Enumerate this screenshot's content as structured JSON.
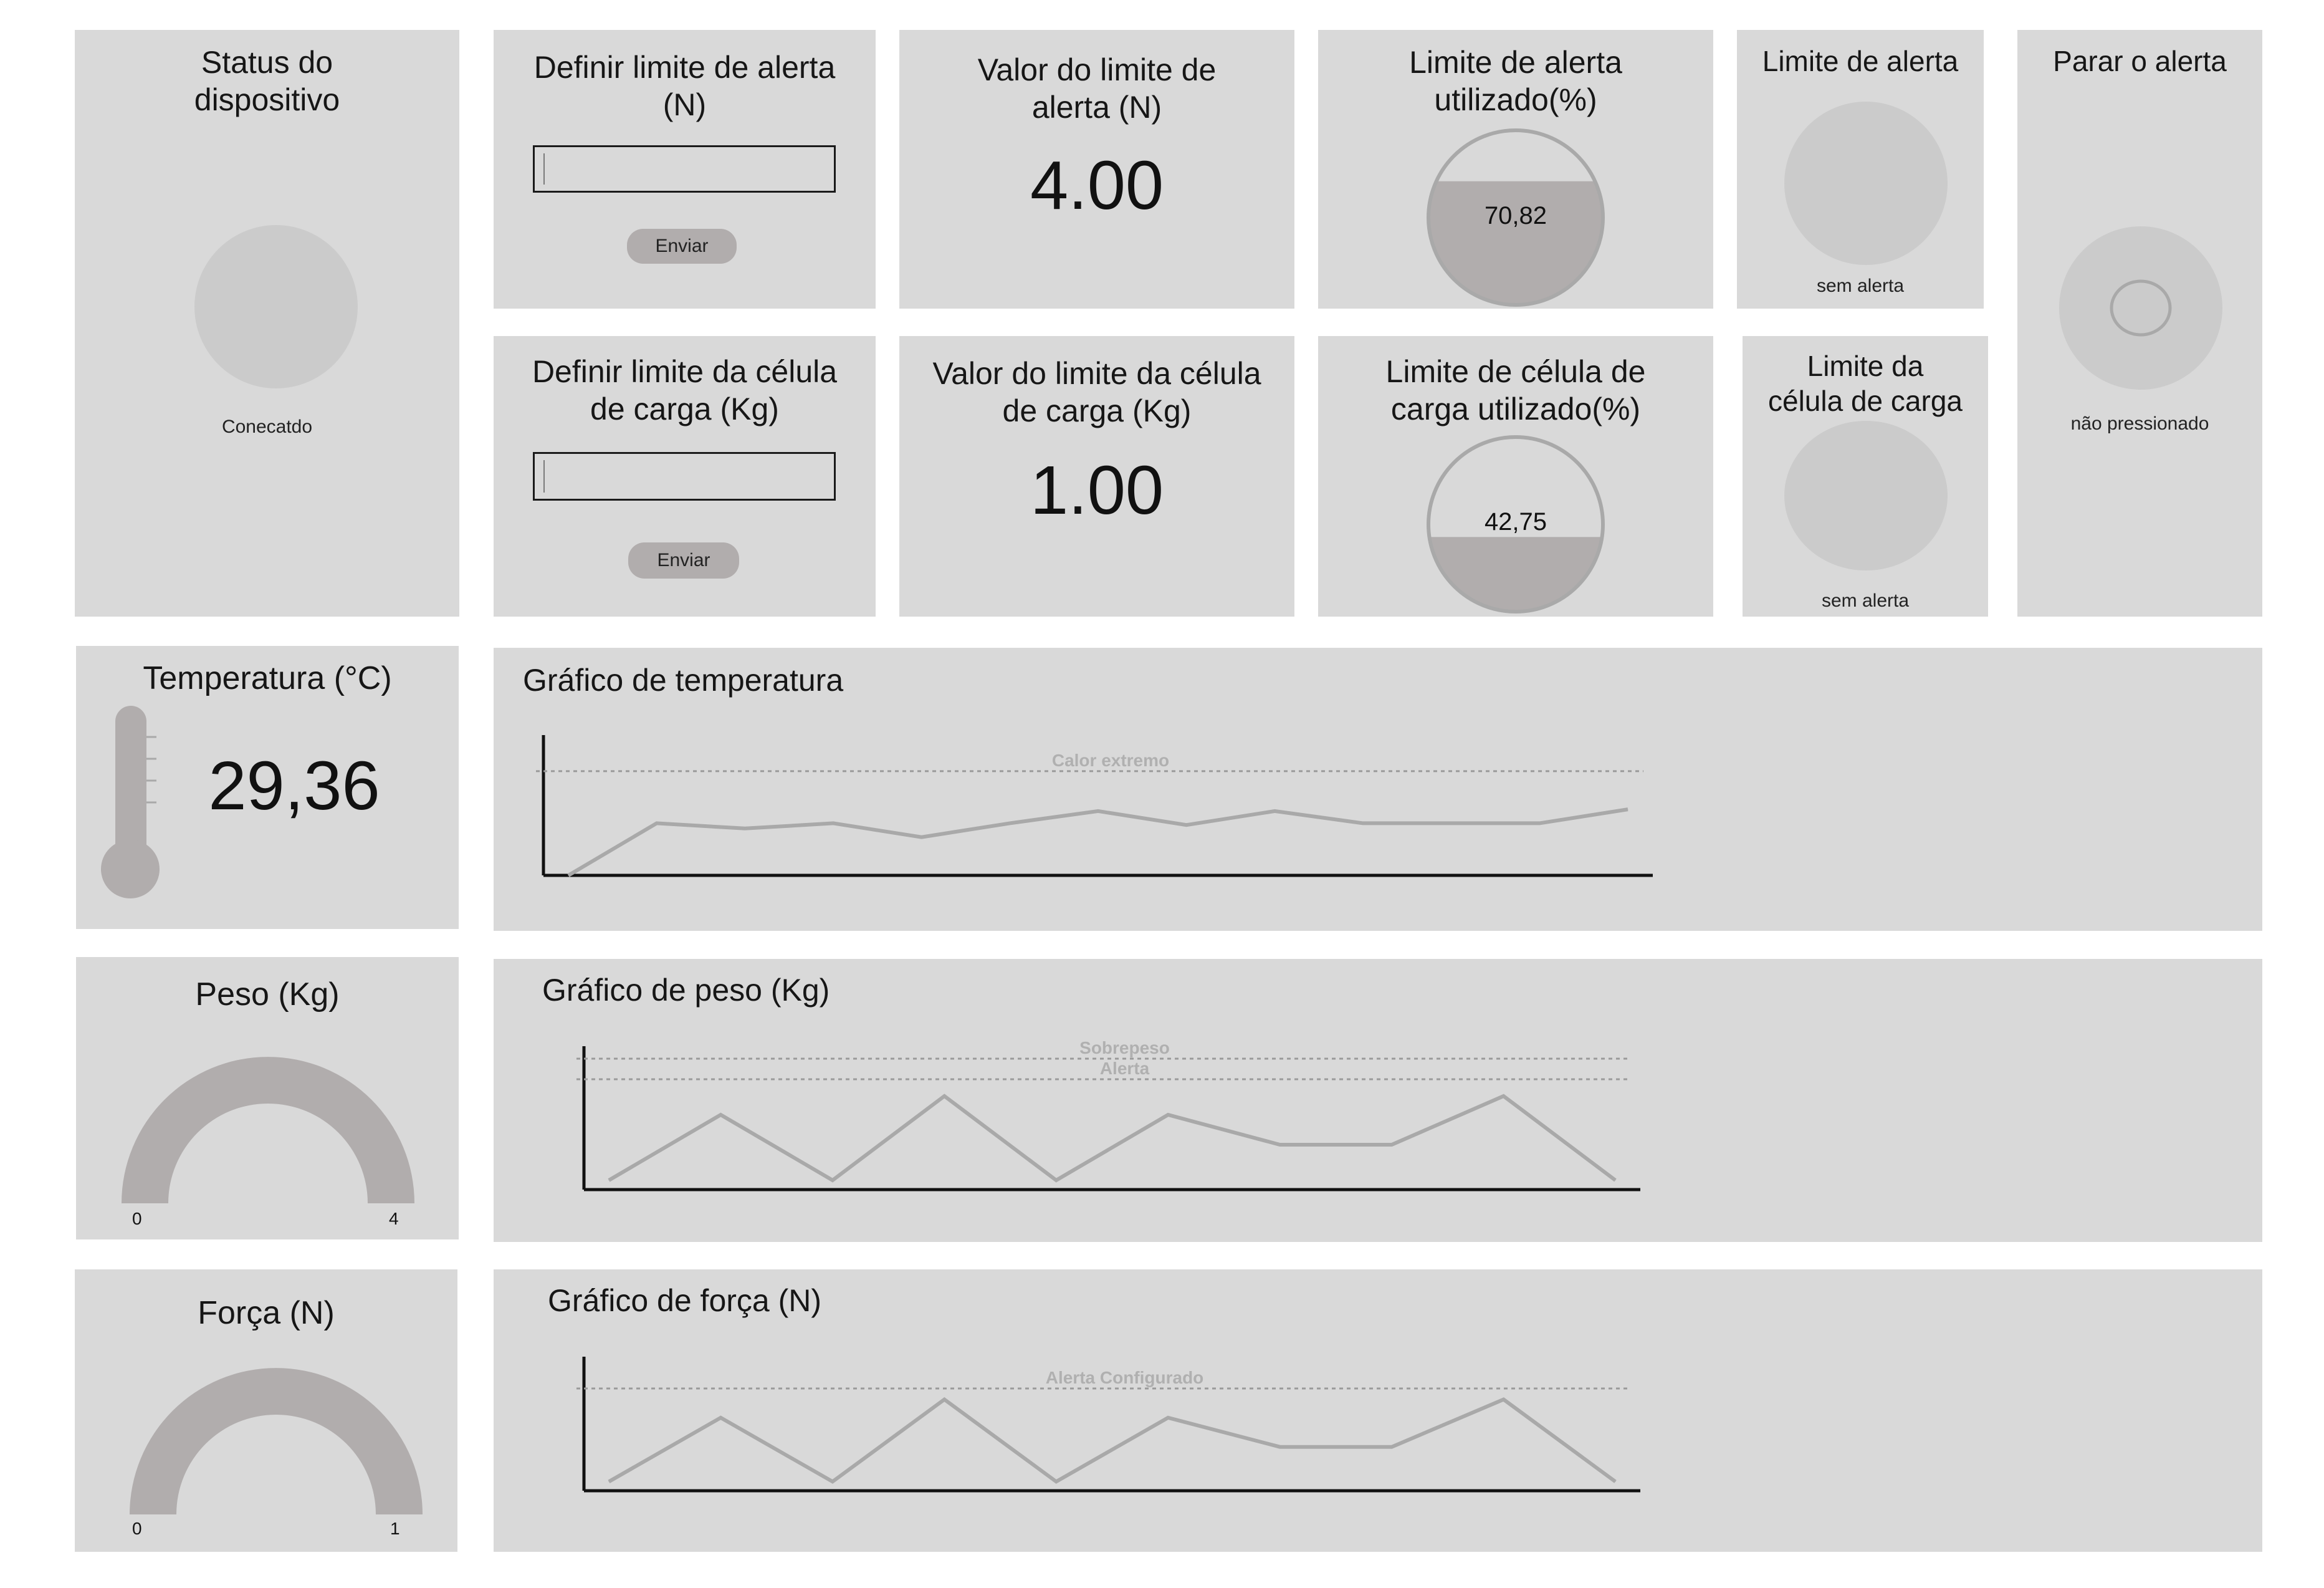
{
  "status": {
    "title": "Status do dispositivo",
    "state": "Conecatdo"
  },
  "set_alert_limit": {
    "title": "Definir limite de alerta (N)",
    "input_value": "",
    "button_label": "Enviar"
  },
  "set_load_limit": {
    "title": "Definir limite da célula de carga (Kg)",
    "input_value": "",
    "button_label": "Enviar"
  },
  "alert_limit_value": {
    "title": "Valor do limite de alerta (N)",
    "value": "4.00"
  },
  "load_limit_value": {
    "title": "Valor do limite da célula de carga (Kg)",
    "value": "1.00"
  },
  "alert_limit_used": {
    "title": "Limite de alerta utilizado(%)",
    "value": "70,82",
    "fraction": 0.7082
  },
  "load_limit_used": {
    "title": "Limite de célula de carga utilizado(%)",
    "value": "42,75",
    "fraction": 0.4275
  },
  "alert_indicator": {
    "title": "Limite de alerta",
    "state": "sem alerta"
  },
  "load_indicator": {
    "title": "Limite da célula de carga",
    "state": "sem alerta"
  },
  "stop_alert": {
    "title": "Parar o alerta",
    "state": "não pressionado"
  },
  "temperature": {
    "title": "Temperatura (°C)",
    "value": "29,36"
  },
  "weight": {
    "title": "Peso (Kg)",
    "min": "0",
    "max": "4"
  },
  "force": {
    "title": "Força (N)",
    "min": "0",
    "max": "1"
  },
  "colors": {
    "panel": "#d9d9d9",
    "accent": "#b1adad",
    "circle": "#cbcbcb",
    "line": "#a9a9a9"
  },
  "chart_data": [
    {
      "type": "line",
      "title": "Gráfico de temperatura",
      "series": [
        {
          "values": [
            0,
            3,
            2.7,
            3,
            2.2,
            3,
            3.7,
            2.9,
            3.7,
            3,
            3,
            3,
            3.8
          ]
        }
      ],
      "reference_lines": [
        {
          "label": "Calor extremo",
          "value": 6
        }
      ],
      "ylim": [
        0,
        7
      ]
    },
    {
      "type": "line",
      "title": "Gráfico de peso (Kg)",
      "series": [
        {
          "values": [
            0.5,
            4,
            0.5,
            5,
            0.5,
            4,
            2.4,
            2.4,
            5,
            0.5
          ]
        }
      ],
      "reference_lines": [
        {
          "label": "Sobrepeso",
          "value": 7
        },
        {
          "label": "Alerta",
          "value": 5.9
        }
      ],
      "ylim": [
        0,
        7
      ]
    },
    {
      "type": "line",
      "title": "Gráfico de força (N)",
      "series": [
        {
          "values": [
            0.5,
            4,
            0.5,
            5,
            0.5,
            4,
            2.4,
            2.4,
            5,
            0.5
          ]
        }
      ],
      "reference_lines": [
        {
          "label": "Alerta Configurado",
          "value": 5.6
        }
      ],
      "ylim": [
        0,
        7
      ]
    }
  ]
}
